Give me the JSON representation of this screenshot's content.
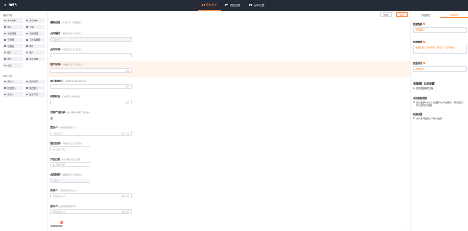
{
  "header": {
    "back_label": "963",
    "tabs": [
      {
        "label": "表单设计",
        "active": true
      },
      {
        "label": "流程设置",
        "active": false
      },
      {
        "label": "表单设置",
        "active": false
      }
    ]
  },
  "left": {
    "basic_title": "基础字段",
    "basic": [
      "单行文本",
      "多行文本",
      "数字",
      "日期",
      "单选按钮",
      "多选按钮",
      "下拉框",
      "下拉多选框",
      "日期区",
      "附件",
      "图片",
      "图片",
      "附件",
      "描述文本",
      "标签"
    ],
    "system_title": "系统字段",
    "system": [
      "创建人",
      "创建时间",
      "所属部门",
      "修改部门",
      "负责人",
      "更多字段"
    ]
  },
  "toolbar": {
    "preview": "预览",
    "save": "保存"
  },
  "form": {
    "section1": {
      "title": "基础信息",
      "sub": "(系统字段-基础信息)"
    },
    "f1": {
      "label": "合同编号",
      "sub": "(系统字段-合同编号)",
      "value": "自动生成"
    },
    "f2": {
      "label": "合同名称",
      "sub": "(系统字段-合同名称)",
      "value": ""
    },
    "f3": {
      "label": "客户名称",
      "sub": "(系统字段-客户名称)",
      "value": "",
      "suffix": "选择"
    },
    "f4": {
      "label": "客户联系人",
      "sub": "(系统字段-客户联系人)",
      "value": "",
      "suffix": "选择"
    },
    "f5": {
      "label": "关联机会",
      "sub": "(系统字段-关联机会)",
      "value": "",
      "suffix": "选择"
    },
    "f6": {
      "label": "关联产品名单",
      "sub": "(系统字段-关联产品名单)",
      "value": "无"
    },
    "f7": {
      "label": "签订人",
      "sub": "(系统字段-签订人)",
      "value": "请选择签订",
      "suffix": "选择人员"
    },
    "f8": {
      "label": "签订日期",
      "sub": "(系统字段-签订日期)",
      "value": "选择日期"
    },
    "f9": {
      "label": "开始日期",
      "sub": "(系统字段-开始日期)",
      "value": "选择日期"
    },
    "f10": {
      "label": "合同状态",
      "sub": "(系统字段-合同状态)",
      "value": "请选择"
    },
    "f11": {
      "label": "负责人",
      "sub": "(系统字段-负责人)",
      "value": "请选择负责人",
      "suffix": "选择人员"
    },
    "f12": {
      "label": "协同人",
      "sub": "(系统字段-协同人)",
      "value": "请选择协同人",
      "suffix": "选择人员"
    },
    "footer": {
      "label": "未使用字段",
      "badge": "3"
    }
  },
  "right": {
    "tabs": [
      {
        "label": "字段属性",
        "active": false
      },
      {
        "label": "表单属性",
        "active": true
      }
    ],
    "data_title": {
      "label": "数据标题",
      "value": "合同编号"
    },
    "data_summary": {
      "label": "数据摘要",
      "tags": [
        "合同名称",
        "客户名称",
        "签订人",
        "合同状态"
      ]
    },
    "data_sort": {
      "label": "数据排序",
      "value": "创建时间"
    },
    "amount_section": "金额金额【公司配置】",
    "amount_option": "启用金额审批流程",
    "plan_section": "实际回款限制",
    "plan_option": "回款金额+收款计划金额≤合同金额时，限制回款计划/关联合同总额",
    "flow_section": "超额设置",
    "flow_option": "允许合同金额大于报价金额"
  }
}
